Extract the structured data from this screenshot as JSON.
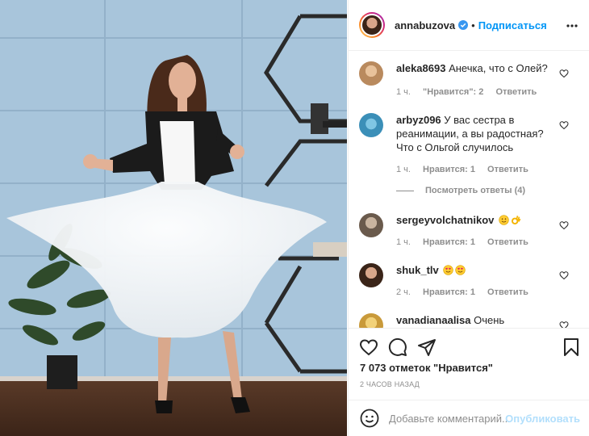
{
  "post": {
    "username": "annabuzova",
    "separator": "•",
    "follow_label": "Подписаться",
    "likes_text": "7 073 отметок \"Нравится\"",
    "time_ago": "2 ЧАСОВ НАЗАД",
    "comment_placeholder": "Добавьте комментарий...",
    "publish_label": "Опубликовать"
  },
  "comments": [
    {
      "user": "aleka8693",
      "text": "Анечка, что с Олей?",
      "time": "1 ч.",
      "likes": "\"Нравится\": 2",
      "reply": "Ответить"
    },
    {
      "user": "arbyz096",
      "text": "У вас сестра в реанимации, а вы радостная? Что с Ольгой случилось",
      "time": "1 ч.",
      "likes": "Нравится: 1",
      "reply": "Ответить"
    },
    {
      "user": "sergeyvolchatnikov",
      "text": "",
      "time": "1 ч.",
      "likes": "Нравится: 1",
      "reply": "Ответить"
    },
    {
      "user": "shuk_tlv",
      "text": "",
      "time": "2 ч.",
      "likes": "Нравится: 1",
      "reply": "Ответить"
    },
    {
      "user": "vanadianaalisa",
      "text": "Очень хороший"
    }
  ],
  "view_replies": "Посмотреть ответы (4)",
  "icons": {
    "verified": "verified-badge-icon",
    "more": "more-options-icon",
    "like": "heart-icon",
    "comment": "comment-icon",
    "share": "share-icon",
    "save": "bookmark-icon",
    "emoji": "emoji-icon"
  },
  "colors": {
    "accent": "#0095f6",
    "muted": "#8e8e8e",
    "publish_disabled": "#b2dffc",
    "wall": "#a9c6dc"
  }
}
